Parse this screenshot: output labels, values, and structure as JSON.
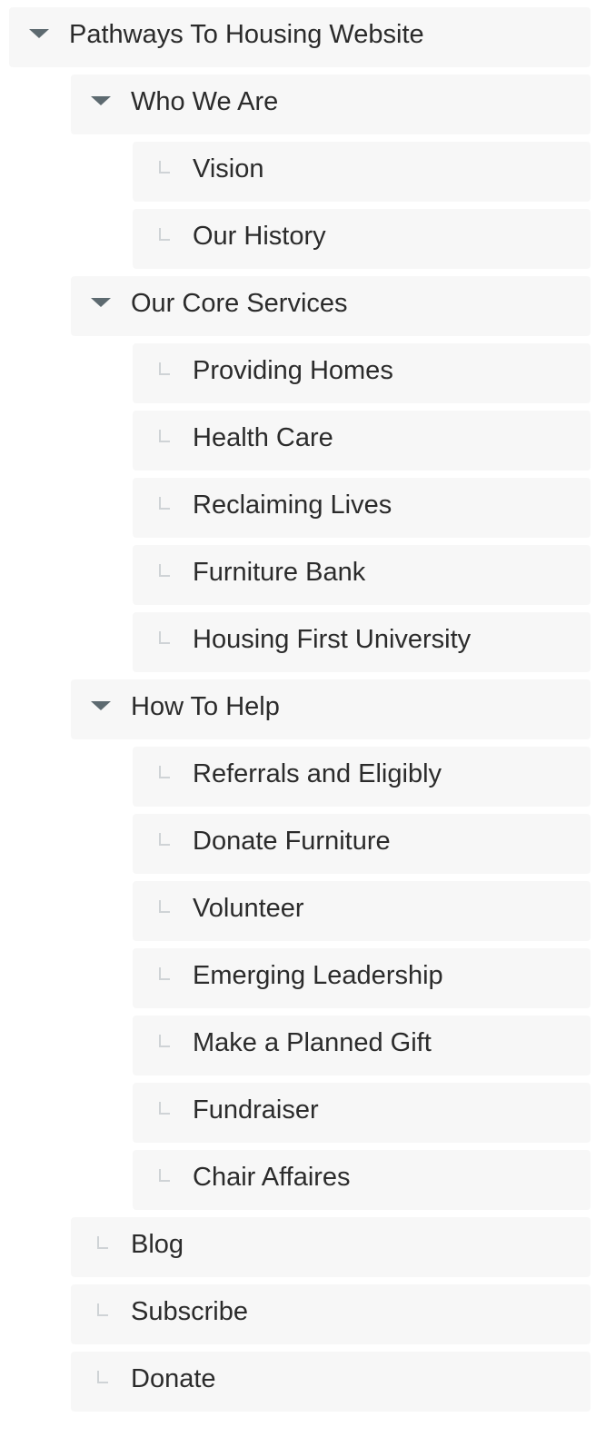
{
  "tree": {
    "root": {
      "label": "Pathways To Housing Website",
      "expanded": true
    },
    "who_we_are": {
      "label": "Who We Are",
      "expanded": true,
      "children": [
        "Vision",
        "Our History"
      ]
    },
    "core_services": {
      "label": "Our Core Services",
      "expanded": true,
      "children": [
        "Providing Homes",
        "Health Care",
        "Reclaiming Lives",
        "Furniture Bank",
        "Housing First University"
      ]
    },
    "how_to_help": {
      "label": "How To Help",
      "expanded": true,
      "children": [
        "Referrals and Eligibly",
        "Donate Furniture",
        "Volunteer",
        "Emerging Leadership",
        "Make a Planned Gift",
        "Fundraiser",
        "Chair Affaires"
      ]
    },
    "top_pages": [
      "Blog",
      "Subscribe",
      "Donate"
    ]
  },
  "icons": {
    "expanded": "caret-down-icon",
    "leaf": "child-page-elbow-icon"
  },
  "colors": {
    "row_background": "#f7f7f7",
    "caret": "#5d6a70",
    "elbow": "#cfd3d6",
    "text": "#2b2b2b"
  }
}
